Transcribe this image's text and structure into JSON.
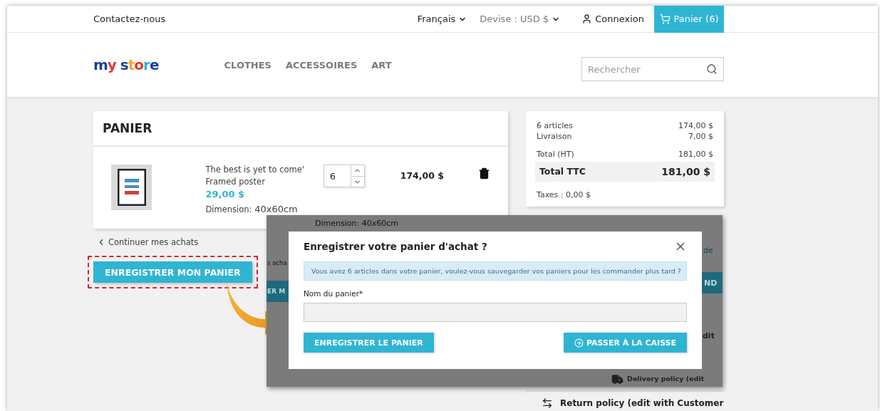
{
  "topbar": {
    "contact": "Contactez-nous",
    "language": "Français",
    "currency": "Devise : USD $",
    "login": "Connexion",
    "cart": "Panier (6)"
  },
  "header": {
    "logo": "my store",
    "nav": [
      "CLOTHES",
      "ACCESSOIRES",
      "ART"
    ],
    "search": {
      "placeholder": "Rechercher"
    }
  },
  "cart": {
    "title": "PANIER",
    "items": [
      {
        "name": "The best is yet to come'",
        "subtitle": "Framed poster",
        "price": "29,00 $",
        "dimension_label": "Dimension:",
        "dimension_value": "40x60cm",
        "quantity": "6",
        "total": "174,00 $"
      }
    ]
  },
  "continue_link": "Continuer mes achats",
  "save_button": "ENREGISTRER MON PANIER",
  "summary": {
    "lines": [
      {
        "label": "6 articles",
        "value": "174,00 $"
      },
      {
        "label": "Livraison",
        "value": "7,00 $"
      }
    ],
    "total_ht": {
      "label": "Total (HT)",
      "value": "181,00 $"
    },
    "total_ttc": {
      "label": "Total TTC",
      "value": "181,00 $"
    },
    "taxes": "Taxes : 0,00 $"
  },
  "policy": "Return policy (edit with Customer",
  "dialog_preview": {
    "dimension": "Dimension: 40x60cm",
    "link_fragment": "s acha",
    "button_fragment": "ER M",
    "right_link_fragment": "de",
    "right_button_fragment": "ND",
    "right_text_fragment": "dit",
    "delivery": "Delivery policy (edit",
    "title": "Enregistrer votre panier d'achat ?",
    "message": "Vous avez 6 articles dans votre panier, voulez-vous sauvegarder vos paniers pour les commander plus tard ?",
    "field_label": "Nom du panier*",
    "save_button": "ENREGISTRER LE PANIER",
    "checkout_button": "PASSER À LA CAISSE"
  }
}
